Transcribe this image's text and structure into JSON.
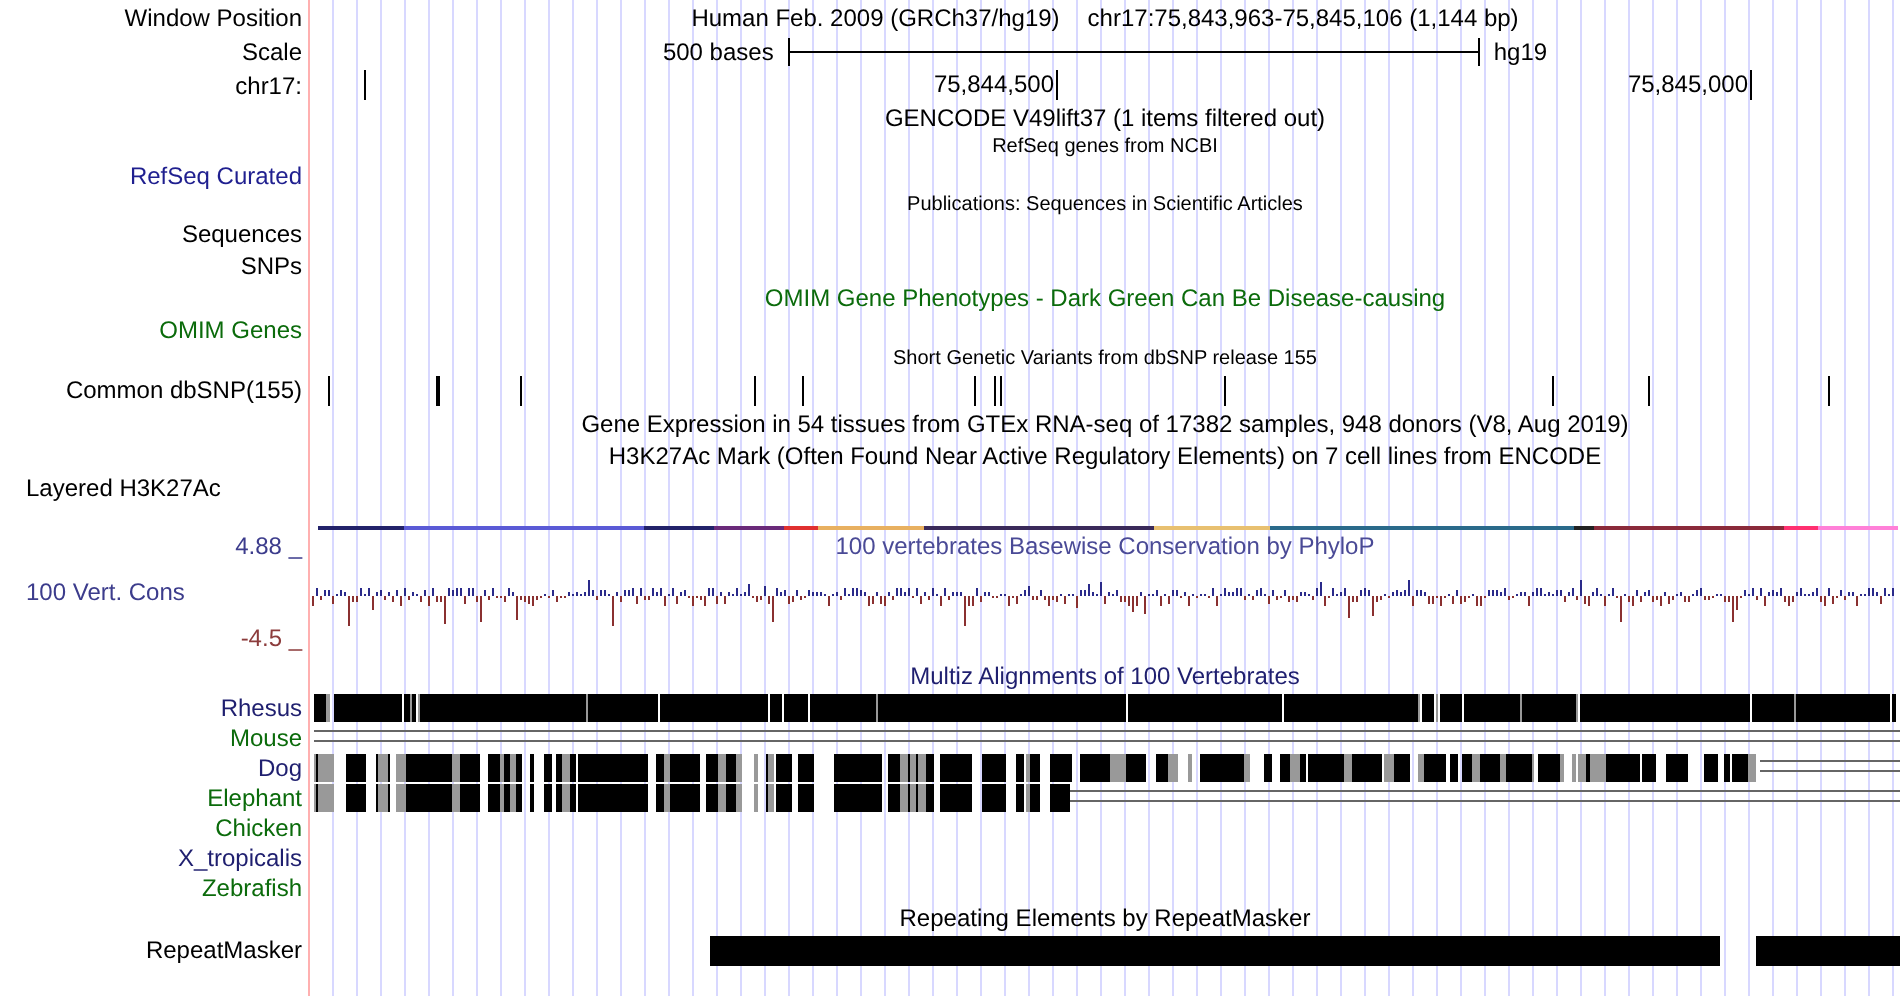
{
  "header": {
    "position_label": "Window Position",
    "assembly_title": "Human Feb. 2009 (GRCh37/hg19)",
    "position": "chr17:75,843,963-75,845,106 (1,144 bp)",
    "scale_label": "Scale",
    "scale_text": "500 bases",
    "scale_assembly": "hg19",
    "chrom_label": "chr17:",
    "ticks": [
      "75,844,500",
      "75,845,000"
    ]
  },
  "tracks": [
    {
      "kind": "title",
      "text": "GENCODE V49lift37 (1 items filtered out)"
    },
    {
      "kind": "subtitle",
      "text": "RefSeq genes from NCBI"
    },
    {
      "kind": "label",
      "label": "RefSeq Curated",
      "color": "#1f1f8f"
    },
    {
      "kind": "subtitle",
      "text": "Publications: Sequences in Scientific Articles"
    },
    {
      "kind": "label",
      "label": "Sequences"
    },
    {
      "kind": "label",
      "label": "SNPs"
    },
    {
      "kind": "title",
      "text": "OMIM Gene Phenotypes - Dark Green Can Be Disease-causing",
      "color": "#0b6b0b"
    },
    {
      "kind": "label",
      "label": "OMIM Genes",
      "color": "#0b6b0b"
    },
    {
      "kind": "subtitle",
      "text": "Short Genetic Variants from dbSNP release 155"
    },
    {
      "kind": "snps",
      "label": "Common dbSNP(155)"
    },
    {
      "kind": "title",
      "text": "Gene Expression in 54 tissues from GTEx RNA-seq of 17382 samples, 948 donors (V8, Aug 2019)"
    },
    {
      "kind": "title",
      "text": "H3K27Ac Mark (Often Found Near Active Regulatory Elements) on 7 cell lines from ENCODE"
    },
    {
      "kind": "signal",
      "label": "Layered H3K27Ac"
    },
    {
      "kind": "wiggle",
      "label": "100 Vert. Cons",
      "title": "100 vertebrates Basewise Conservation by PhyloP",
      "max": "4.88 _",
      "min": "-4.5 _"
    },
    {
      "kind": "title",
      "text": "Multiz Alignments of 100 Vertebrates",
      "color": "#1f1f6f"
    },
    {
      "kind": "dense",
      "label": "Rhesus",
      "color": "#1f1f6f"
    },
    {
      "kind": "lines",
      "label": "Mouse",
      "color": "#0b6b0b"
    },
    {
      "kind": "partial",
      "label": "Dog",
      "color": "#1f1f6f"
    },
    {
      "kind": "short",
      "label": "Elephant",
      "color": "#0b6b0b"
    },
    {
      "kind": "species",
      "label": "Chicken",
      "color": "#0b6b0b"
    },
    {
      "kind": "species",
      "label": "X_tropicalis",
      "color": "#1f1f6f"
    },
    {
      "kind": "species",
      "label": "Zebrafish",
      "color": "#0b6b0b"
    },
    {
      "kind": "title",
      "text": "Repeating Elements by RepeatMasker"
    },
    {
      "kind": "blocks",
      "label": "RepeatMasker"
    }
  ]
}
